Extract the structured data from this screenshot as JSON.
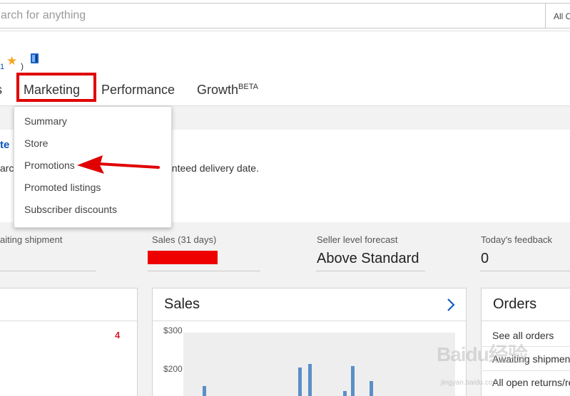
{
  "search": {
    "placeholder": "arch for anything",
    "category": "All C"
  },
  "header": {
    "user_fragment": "1",
    "paren": ")",
    "nav_left_fragment": "s"
  },
  "nav": {
    "marketing": "Marketing",
    "performance": "Performance",
    "growth": "Growth",
    "growth_badge": "BETA"
  },
  "dropdown": {
    "items": [
      "Summary",
      "Store",
      "Promotions",
      "Promoted listings",
      "Subscriber discounts"
    ]
  },
  "banner": {
    "title_fragment": "te",
    "text_left": "arc",
    "text_right": "anteed delivery date."
  },
  "stats": [
    {
      "label": "aiting shipment",
      "value": ""
    },
    {
      "label": "Sales (31 days)",
      "value": ""
    },
    {
      "label": "Seller level forecast",
      "value": "Above Standard"
    },
    {
      "label": "Today's feedback",
      "value": "0"
    }
  ],
  "cards": {
    "left": {
      "count": "4"
    },
    "sales": {
      "title": "Sales",
      "ticks": [
        "$300",
        "$200"
      ]
    },
    "orders": {
      "title": "Orders",
      "links": [
        "See all orders",
        "Awaiting shipment",
        "All open returns/re"
      ]
    }
  },
  "watermark": {
    "main": "Baidu经验",
    "sub": "jingyan.baidu.com"
  },
  "colors": {
    "link_blue": "#0654ba",
    "annotation_red": "#e00000",
    "bar_blue": "#5b8fc7",
    "alert_red": "#dd1e31"
  }
}
